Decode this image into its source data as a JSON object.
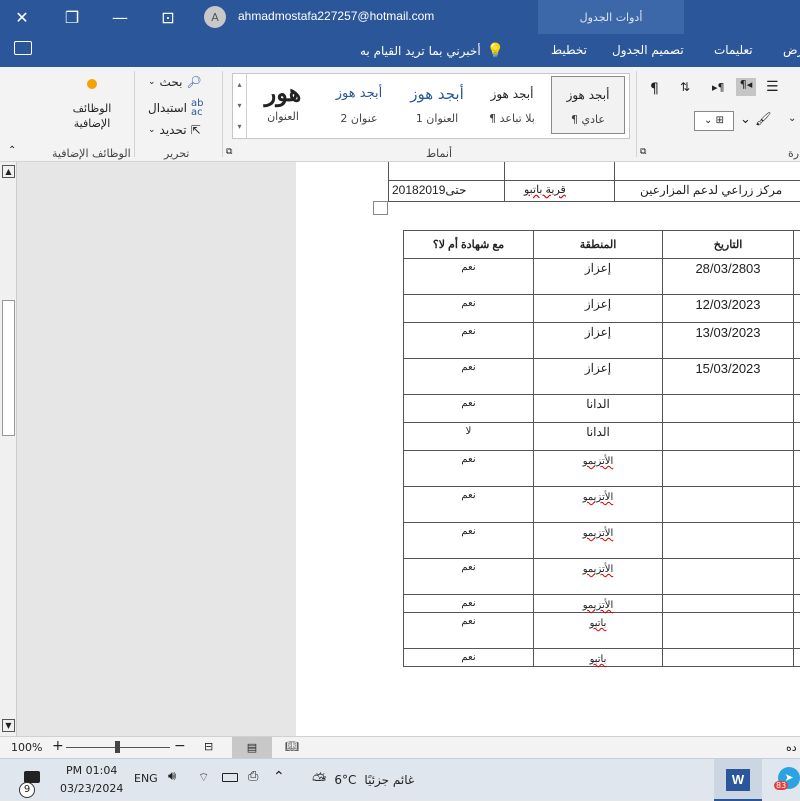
{
  "window": {
    "close": "✕",
    "restore": "❐",
    "minimize": "—",
    "tabview": "⊡",
    "avatar_letter": "A",
    "account": "ahmadmostafa227257@hotmail.com",
    "contextual_tab": "أدوات الجدول"
  },
  "tabs": {
    "tell_me": "أخبرني بما تريد القيام به",
    "layout": "تخطيط",
    "table_design": "تصميم الجدول",
    "help": "تعليمات",
    "view": "رض"
  },
  "ribbon": {
    "addins_label": "الوظائف الإضافية",
    "addins_group": "الوظائف الإضافية",
    "editing_group": "تحرير",
    "find": "بحث",
    "replace": "استبدال",
    "select": "تحديد",
    "styles_group": "أنماط",
    "paragraph_group_fragment": "رة",
    "styles": [
      {
        "preview": "أبجد هوز",
        "name": "¶ عادي"
      },
      {
        "preview": "أبجد هوز",
        "name": "¶ بلا تباعد"
      },
      {
        "preview": "أبجد هوز",
        "name": "العنوان 1"
      },
      {
        "preview": "أبجد هوز",
        "name": "عنوان 2"
      },
      {
        "preview": "هور",
        "name": "العنوان"
      }
    ]
  },
  "document": {
    "top_row": {
      "c1": "2018حتى2019",
      "c2": "قرية باتبو",
      "c3": "مركز زراعي لدعم المزارعين"
    },
    "headers": {
      "cert": "مع شهادة أم لا؟",
      "region": "المنطقة",
      "date": "التاريخ"
    },
    "rows": [
      {
        "cert": "نعم",
        "region": "إعزاز",
        "date": "28/03/2803"
      },
      {
        "cert": "نعم",
        "region": "إعزاز",
        "date": "12/03/2023"
      },
      {
        "cert": "نعم",
        "region": "إعزاز",
        "date": "13/03/2023"
      },
      {
        "cert": "نعم",
        "region": "إعزاز",
        "date": "15/03/2023"
      },
      {
        "cert": "نعم",
        "region": "الدانا",
        "date": ""
      },
      {
        "cert": "لا",
        "region": "الدانا",
        "date": ""
      },
      {
        "cert": "نعم",
        "region": "الأتزيمو",
        "date": ""
      },
      {
        "cert": "نعم",
        "region": "الأتزيمو",
        "date": ""
      },
      {
        "cert": "نعم",
        "region": "الأتزيمو",
        "date": ""
      },
      {
        "cert": "نعم",
        "region": "الأتزيمو",
        "date": ""
      },
      {
        "cert": "نعم",
        "region": "الأتزيمو",
        "date": ""
      },
      {
        "cert": "نعم",
        "region": "باتبو",
        "date": ""
      },
      {
        "cert": "نعم",
        "region": "باتبو",
        "date": ""
      }
    ]
  },
  "status": {
    "zoom": "100%",
    "right_fragment": "ده"
  },
  "taskbar": {
    "time": "PM 01:04",
    "date": "03/23/2024",
    "lang": "ENG",
    "weather_text": "غائم جزئيًا",
    "temperature": "6°C",
    "notifications": "9",
    "badge": "83"
  },
  "colors": {
    "accent": "#2b579a",
    "spell": "#d00000"
  }
}
